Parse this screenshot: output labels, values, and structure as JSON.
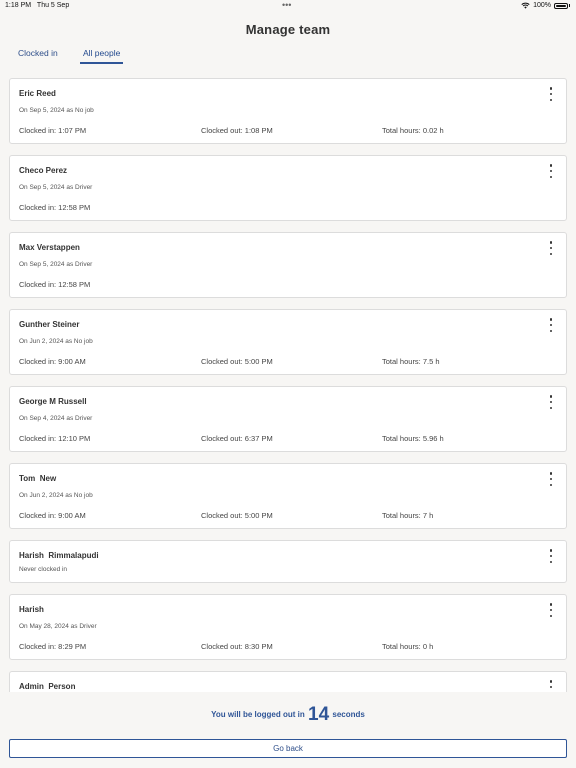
{
  "status_bar": {
    "time": "1:18 PM",
    "date": "Thu 5 Sep",
    "battery": "100%",
    "wifi_icon": "wifi-icon",
    "more_icon": "more-dots-icon"
  },
  "title": "Manage team",
  "tabs": [
    {
      "label": "Clocked in"
    },
    {
      "label": "All people",
      "selected": true
    }
  ],
  "people": [
    {
      "name": "Eric Reed",
      "sub": "On Sep 5, 2024 as No job",
      "clocked_in": "Clocked in: 1:07 PM",
      "clocked_out": "Clocked out: 1:08 PM",
      "total": "Total hours: 0.02 h"
    },
    {
      "name": "Checo Perez",
      "sub": "On Sep 5, 2024 as Driver",
      "clocked_in": "Clocked in: 12:58 PM",
      "clocked_out": "",
      "total": ""
    },
    {
      "name": "Max Verstappen",
      "sub": "On Sep 5, 2024 as Driver",
      "clocked_in": "Clocked in: 12:58 PM",
      "clocked_out": "",
      "total": ""
    },
    {
      "name": "Gunther Steiner",
      "sub": "On Jun 2, 2024 as No job",
      "clocked_in": "Clocked in: 9:00 AM",
      "clocked_out": "Clocked out: 5:00 PM",
      "total": "Total hours: 7.5 h"
    },
    {
      "name": "George M Russell",
      "sub": "On Sep 4, 2024 as Driver",
      "clocked_in": "Clocked in: 12:10 PM",
      "clocked_out": "Clocked out: 6:37 PM",
      "total": "Total hours: 5.96 h"
    },
    {
      "name": "Tom  New",
      "sub": "On Jun 2, 2024 as No job",
      "clocked_in": "Clocked in: 9:00 AM",
      "clocked_out": "Clocked out: 5:00 PM",
      "total": "Total hours: 7 h"
    },
    {
      "name": "Harish  Rimmalapudi",
      "sub": "Never clocked in",
      "clocked_in": "",
      "clocked_out": "",
      "total": ""
    },
    {
      "name": "Harish",
      "sub": "On May 28, 2024 as Driver",
      "clocked_in": "Clocked in: 8:29 PM",
      "clocked_out": "Clocked out: 8:30 PM",
      "total": "Total hours: 0 h"
    },
    {
      "name": "Admin  Person",
      "sub": "",
      "clocked_in": "",
      "clocked_out": "",
      "total": ""
    }
  ],
  "logout": {
    "prefix": "You will be logged out in",
    "count": "14",
    "suffix": "seconds"
  },
  "go_back_label": "Go back",
  "colors": {
    "accent": "#2f5597",
    "background": "#f7f6f4",
    "card": "#ffffff"
  }
}
